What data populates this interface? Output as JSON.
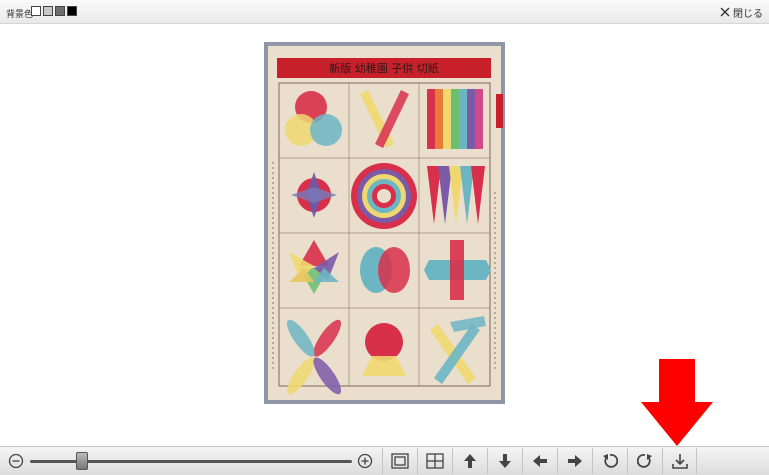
{
  "topbar": {
    "background_label": "背景色",
    "swatches": [
      {
        "name": "white",
        "color": "#ffffff"
      },
      {
        "name": "light-gray",
        "color": "#c8c8c8"
      },
      {
        "name": "dark-gray",
        "color": "#6e6e6e"
      },
      {
        "name": "black",
        "color": "#000000"
      }
    ],
    "close_label": "閉じる"
  },
  "print": {
    "title_band": "新版 幼稚園 子供 切紙"
  },
  "toolbar": {
    "zoom_level": 0.16,
    "buttons": [
      {
        "name": "fit-page-button",
        "icon": "fit-page-icon"
      },
      {
        "name": "fit-width-button",
        "icon": "fit-width-icon"
      },
      {
        "name": "move-up-button",
        "icon": "arrow-up-icon"
      },
      {
        "name": "move-down-button",
        "icon": "arrow-down-icon"
      },
      {
        "name": "move-left-button",
        "icon": "arrow-left-icon"
      },
      {
        "name": "move-right-button",
        "icon": "arrow-right-icon"
      },
      {
        "name": "rotate-left-button",
        "icon": "rotate-left-icon"
      },
      {
        "name": "rotate-right-button",
        "icon": "rotate-right-icon"
      },
      {
        "name": "download-button",
        "icon": "download-icon"
      }
    ]
  },
  "colors": {
    "annotation_arrow": "#ff0000",
    "toolbar_icon": "#444444"
  }
}
